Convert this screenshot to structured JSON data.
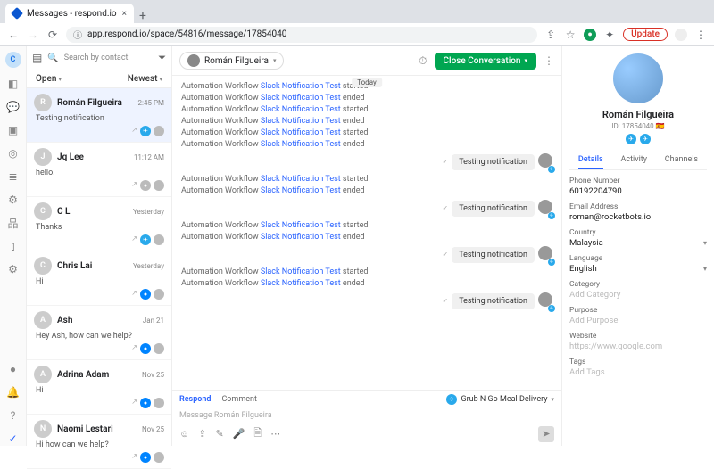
{
  "browser": {
    "tab_title": "Messages - respond.io",
    "url": "app.respond.io/space/54816/message/17854040",
    "update": "Update"
  },
  "rail_avatar": "C",
  "conv": {
    "search_ph": "Search by contact",
    "tab_open": "Open",
    "tab_sort": "Newest",
    "items": [
      {
        "name": "Román Filgueira",
        "time": "2:45 PM",
        "preview": "Testing notification",
        "sel": true,
        "ch": "tg"
      },
      {
        "name": "Jq Lee",
        "time": "11:12 AM",
        "preview": "hello.",
        "ch": "asg"
      },
      {
        "name": "C L",
        "time": "Yesterday",
        "preview": "Thanks",
        "ch": "tg"
      },
      {
        "name": "Chris Lai",
        "time": "Yesterday",
        "preview": "Hi",
        "ch": "fb"
      },
      {
        "name": "Ash",
        "time": "Jan 21",
        "preview": "Hey Ash, how can we help?",
        "ch": "fb"
      },
      {
        "name": "Adrina Adam",
        "time": "Nov 25",
        "preview": "Hi",
        "ch": "fb"
      },
      {
        "name": "Naomi Lestari",
        "time": "Nov 25",
        "preview": "Hi how can we help?",
        "ch": "fb"
      }
    ]
  },
  "thread": {
    "contact": "Román Filgueira",
    "close": "Close Conversation",
    "day": "Today",
    "sys_prefix": "Automation Workflow ",
    "sys_link": "Slack Notification Test",
    "started": " started",
    "ended": " ended",
    "out_msg": "Testing notification",
    "compose": {
      "respond": "Respond",
      "comment": "Comment",
      "channel": "Grub N Go Meal Delivery",
      "placeholder": "Message Román Filgueira"
    }
  },
  "details": {
    "name": "Román Filgueira",
    "id": "ID: 17854040",
    "tabs": {
      "details": "Details",
      "activity": "Activity",
      "channels": "Channels"
    },
    "phone_l": "Phone Number",
    "phone": "60192204790",
    "email_l": "Email Address",
    "email": "roman@rocketbots.io",
    "country_l": "Country",
    "country": "Malaysia",
    "lang_l": "Language",
    "lang": "English",
    "cat_l": "Category",
    "cat_ph": "Add Category",
    "purpose_l": "Purpose",
    "purpose_ph": "Add Purpose",
    "web_l": "Website",
    "web": "https://www.google.com",
    "tags_l": "Tags",
    "tags_ph": "Add Tags"
  }
}
